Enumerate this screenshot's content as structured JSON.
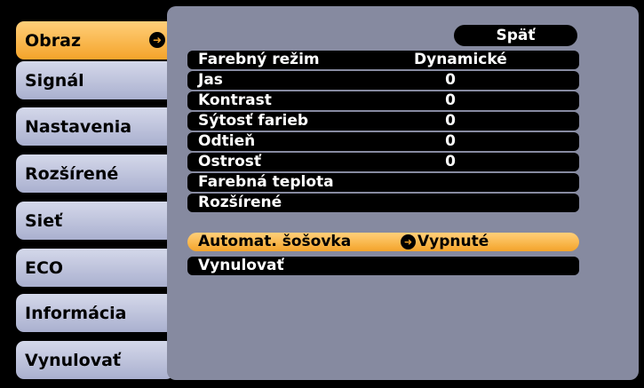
{
  "sidebar": {
    "items": [
      {
        "label": "Obraz"
      },
      {
        "label": "Signál"
      },
      {
        "label": "Nastavenia"
      },
      {
        "label": "Rozšírené"
      },
      {
        "label": "Sieť"
      },
      {
        "label": "ECO"
      },
      {
        "label": "Informácia"
      },
      {
        "label": "Vynulovať"
      }
    ],
    "active_index": 0
  },
  "main": {
    "back_label": "Späť",
    "rows": [
      {
        "label": "Farebný režim",
        "value": "Dynamické"
      },
      {
        "label": "Jas",
        "value": "0"
      },
      {
        "label": "Kontrast",
        "value": "0"
      },
      {
        "label": "Sýtosť farieb",
        "value": "0"
      },
      {
        "label": "Odtieň",
        "value": "0"
      },
      {
        "label": "Ostrosť",
        "value": "0"
      },
      {
        "label": "Farebná teplota",
        "value": ""
      },
      {
        "label": "Rozšírené",
        "value": ""
      },
      {
        "label": "Automat. šošovka",
        "value": "Vypnuté"
      },
      {
        "label": "Vynulovať",
        "value": ""
      }
    ],
    "selected_index": 8
  },
  "colors": {
    "active_orange": "#f4a42a",
    "tab_lavender": "#c3c8df",
    "panel_gray": "#868aa0"
  }
}
